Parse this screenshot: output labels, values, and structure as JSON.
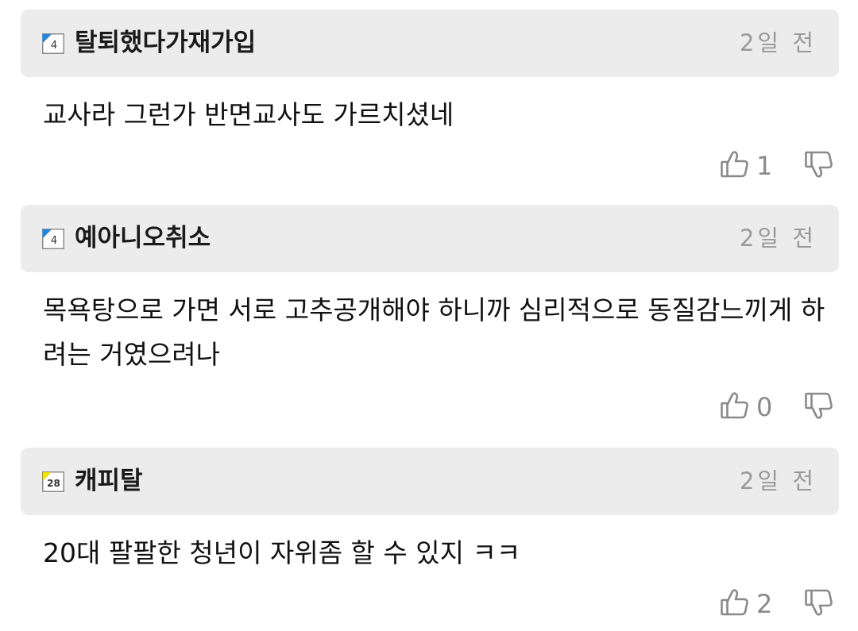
{
  "comments": [
    {
      "level": "4",
      "level_color": "#1e88e5",
      "nickname": "탈퇴했다가재가입",
      "time": "2일 전",
      "text": "교사라 그런가 반면교사도 가르치셨네",
      "likes": "1",
      "like_icon": "thumbs-up-outline",
      "dislike_icon": "thumbs-down-outline"
    },
    {
      "level": "4",
      "level_color": "#1e88e5",
      "nickname": "예아니오취소",
      "time": "2일 전",
      "text": "목욕탕으로 가면 서로 고추공개해야 하니까 심리적으로 동질감느끼게 하려는 거였으려나",
      "likes": "0",
      "like_icon": "thumbs-up-outline",
      "dislike_icon": "thumbs-down-outline"
    },
    {
      "level": "28",
      "level_color": "#f5e400",
      "nickname": "캐피탈",
      "time": "2일 전",
      "text": "20대 팔팔한 청년이 자위좀 할 수 있지 ㅋㅋ",
      "likes": "2",
      "like_icon": "thumbs-up-outline",
      "dislike_icon": "thumbs-down-outline"
    }
  ]
}
